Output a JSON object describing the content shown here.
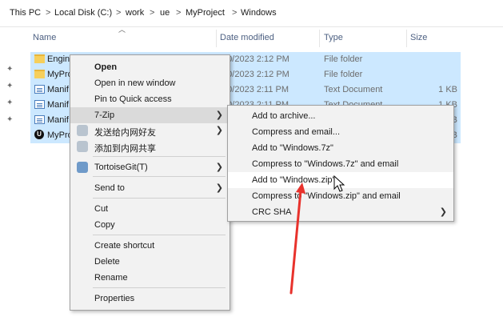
{
  "breadcrumb": [
    "This PC",
    "Local Disk (C:)",
    "work",
    "ue",
    "MyProject",
    "Windows"
  ],
  "breadcrumb_sep": ">",
  "columns": {
    "name": "Name",
    "date": "Date modified",
    "type": "Type",
    "size": "Size"
  },
  "files": [
    {
      "name": "Engin",
      "date": "/20/2023 2:12 PM",
      "type": "File folder",
      "size": "",
      "icon": "folder-icon"
    },
    {
      "name": "MyPro",
      "date": "/20/2023 2:12 PM",
      "type": "File folder",
      "size": "",
      "icon": "folder-icon"
    },
    {
      "name": "Manif",
      "date": "/20/2023 2:11 PM",
      "type": "Text Document",
      "size": "1 KB",
      "icon": "text-document-icon"
    },
    {
      "name": "Manif",
      "date": "/20/2023 2:11 PM",
      "type": "Text Document",
      "size": "1 KB",
      "icon": "text-document-icon"
    },
    {
      "name": "Manif",
      "date": "",
      "type": "",
      "size": "KB",
      "icon": "text-document-icon"
    },
    {
      "name": "MyPro",
      "date": "",
      "type": "",
      "size": "KB",
      "icon": "unreal-engine-icon"
    }
  ],
  "context_menu": {
    "open": "Open",
    "open_new_window": "Open in new window",
    "pin_quick_access": "Pin to Quick access",
    "seven_zip": "7-Zip",
    "send_to_friend": "发送给内网好友",
    "add_to_share": "添加到内网共享",
    "tortoisegit": "TortoiseGit(T)",
    "send_to": "Send to",
    "cut": "Cut",
    "copy": "Copy",
    "create_shortcut": "Create shortcut",
    "delete": "Delete",
    "rename": "Rename",
    "properties": "Properties"
  },
  "seven_zip_menu": {
    "add_archive": "Add to archive...",
    "compress_email": "Compress and email...",
    "add_7z": "Add to \"Windows.7z\"",
    "compress_7z_email": "Compress to \"Windows.7z\" and email",
    "add_zip": "Add to \"Windows.zip\"",
    "compress_zip_email": "Compress to \"Windows.zip\" and email",
    "crc_sha": "CRC SHA"
  },
  "colors": {
    "selection": "#cce8ff",
    "menu_bg": "#f2f2f2",
    "annotation_arrow": "#e8322c"
  }
}
